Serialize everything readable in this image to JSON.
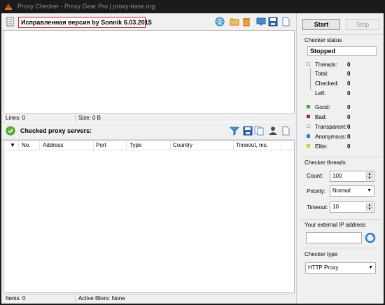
{
  "window": {
    "title": "Proxy Checker - Proxy Gear Pro | proxy-base.org"
  },
  "upper_panel": {
    "version_text": "Исправленная версия by Sonnik 6.03.2015",
    "icons": [
      "add-list-icon",
      "globe-icon",
      "open-folder-icon",
      "trash-icon",
      "import-icon",
      "save-icon",
      "new-document-icon"
    ],
    "statusbar": {
      "lines": "Lines: 0",
      "size": "Size: 0 B"
    }
  },
  "lower_panel": {
    "title": "Checked proxy servers:",
    "icons": [
      "check-icon",
      "filter-icon",
      "save-icon",
      "copy-icon",
      "user-icon",
      "new-document-icon"
    ],
    "columns": [
      "No.",
      "Address",
      "Port",
      "Type",
      "Country",
      "Timeout, ms."
    ],
    "rows": [],
    "statusbar": {
      "items": "Items: 0",
      "filters": "Active filters: None"
    }
  },
  "side": {
    "start_label": "Start",
    "stop_label": "Stop",
    "status_group": {
      "title": "Checker status",
      "status": "Stopped",
      "threads": {
        "label": "Threads:",
        "value": "0"
      },
      "total": {
        "label": "Total:",
        "value": "0"
      },
      "checked": {
        "label": "Checked:",
        "value": "0"
      },
      "left": {
        "label": "Left:",
        "value": "0"
      },
      "good": {
        "label": "Good:",
        "value": "0",
        "color": "#2eb82e"
      },
      "bad": {
        "label": "Bad:",
        "value": "0",
        "color": "#c02020"
      },
      "transparent": {
        "label": "Transparent:",
        "value": "0",
        "color": "#ffffff"
      },
      "anonymous": {
        "label": "Anonymous:",
        "value": "0",
        "color": "#2a7fd4"
      },
      "elite": {
        "label": "Elite:",
        "value": "0",
        "color": "#d8d030"
      }
    },
    "threads_group": {
      "title": "Checker threads",
      "count_label": "Count:",
      "count_value": "100",
      "priority_label": "Priority:",
      "priority_value": "Normal",
      "timeout_label": "Timeout:",
      "timeout_value": "10"
    },
    "ip_group": {
      "title": "Your external IP address",
      "ip_value": ""
    },
    "type_group": {
      "title": "Checker type",
      "type_value": "HTTP Proxy"
    }
  }
}
